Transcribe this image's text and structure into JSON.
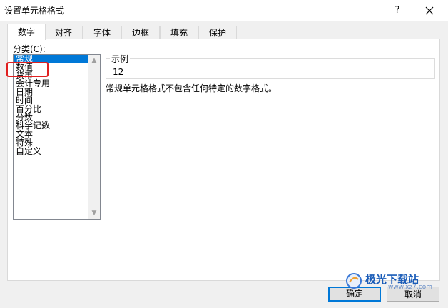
{
  "window": {
    "title": "设置单元格格式",
    "help_label": "?"
  },
  "tabs": [
    "数字",
    "对齐",
    "字体",
    "边框",
    "填充",
    "保护"
  ],
  "active_tab": "数字",
  "category": {
    "label": "分类(C):",
    "items": [
      "常规",
      "数值",
      "货币",
      "会计专用",
      "日期",
      "时间",
      "百分比",
      "分数",
      "科学记数",
      "文本",
      "特殊",
      "自定义"
    ],
    "selected": "常规"
  },
  "sample": {
    "legend": "示例",
    "value": "12"
  },
  "description": "常规单元格格式不包含任何特定的数字格式。",
  "buttons": {
    "ok": "确定",
    "cancel": "取消"
  },
  "watermark": {
    "name": "极光下载站",
    "url": "www.xz7.com"
  },
  "colors": {
    "selection": "#0078d7",
    "highlight_box": "#e02020",
    "dialog_bg": "#f0f0f0"
  }
}
